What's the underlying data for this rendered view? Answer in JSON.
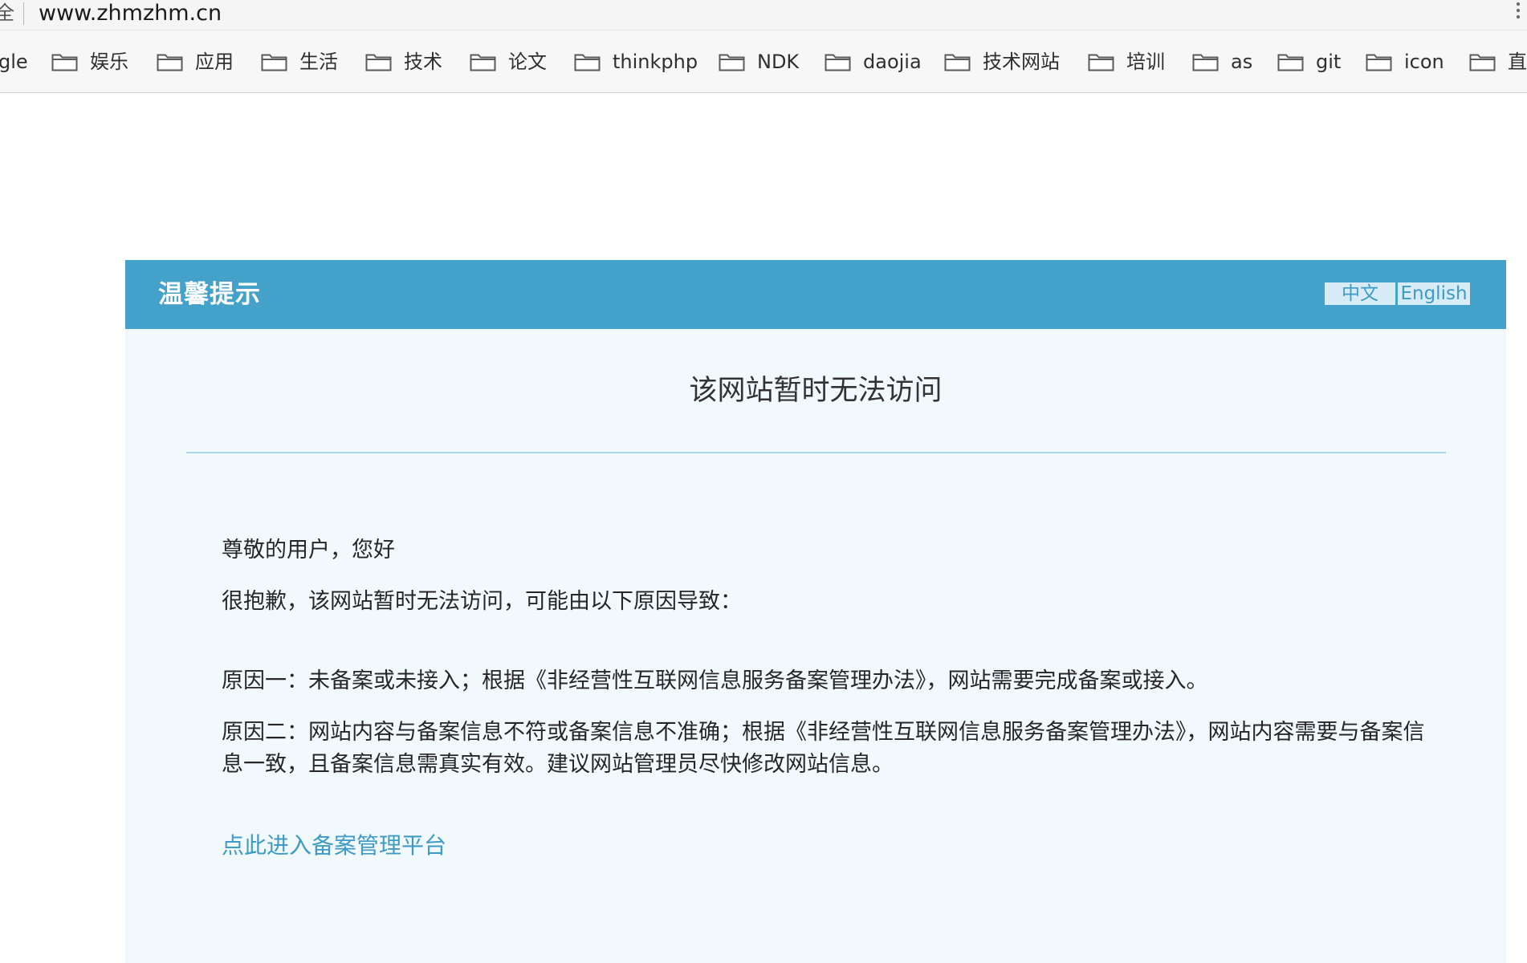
{
  "browser": {
    "lock_glyph": "全",
    "url": "www.zhmzhm.cn"
  },
  "bookmarks": [
    {
      "label": "gle",
      "has_icon": false
    },
    {
      "label": "娱乐",
      "has_icon": true
    },
    {
      "label": "应用",
      "has_icon": true
    },
    {
      "label": "生活",
      "has_icon": true
    },
    {
      "label": "技术",
      "has_icon": true
    },
    {
      "label": "论文",
      "has_icon": true
    },
    {
      "label": "thinkphp",
      "has_icon": true
    },
    {
      "label": "NDK",
      "has_icon": true
    },
    {
      "label": "daojia",
      "has_icon": true
    },
    {
      "label": "技术网站",
      "has_icon": true
    },
    {
      "label": "培训",
      "has_icon": true
    },
    {
      "label": "as",
      "has_icon": true
    },
    {
      "label": "git",
      "has_icon": true
    },
    {
      "label": "icon",
      "has_icon": true
    },
    {
      "label": "直",
      "has_icon": true
    }
  ],
  "notice": {
    "title": "温馨提示",
    "lang_zh": "中文",
    "lang_en": "English",
    "heading": "该网站暂时无法访问",
    "greeting": "尊敬的用户，您好",
    "apology": "很抱歉，该网站暂时无法访问，可能由以下原因导致：",
    "reason1": "原因一：未备案或未接入；根据《非经营性互联网信息服务备案管理办法》，网站需要完成备案或接入。",
    "reason2": "原因二：网站内容与备案信息不符或备案信息不准确；根据《非经营性互联网信息服务备案管理办法》，网站内容需要与备案信息一致，且备案信息需真实有效。建议网站管理员尽快修改网站信息。",
    "link": "点此进入备案管理平台"
  },
  "colors": {
    "header_blue": "#44a1c9",
    "panel_bg": "#f1f9fd",
    "link_blue": "#3e9ac6"
  }
}
